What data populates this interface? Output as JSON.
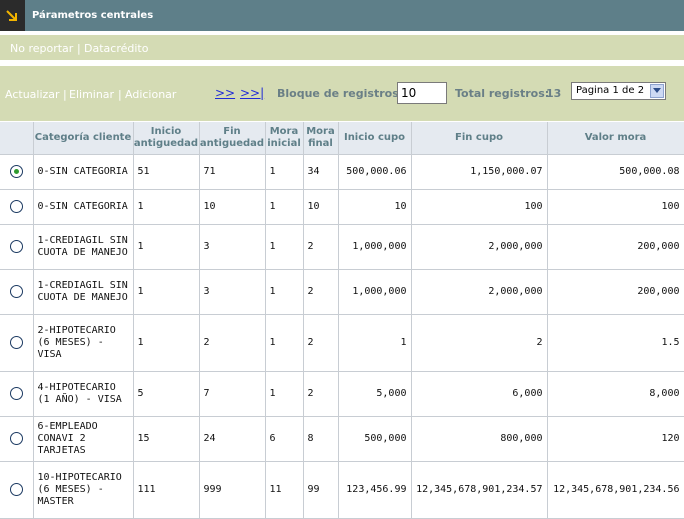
{
  "header": {
    "title": "Párametros centrales"
  },
  "subnav": {
    "no_reportar": "No reportar",
    "separator": "|",
    "datacredito": "Datacrédito"
  },
  "toolbar": {
    "actualizar": "Actualizar",
    "eliminar": "Eliminar",
    "adicionar": "Adicionar",
    "separator": "|",
    "next_link": ">>",
    "last_link": ">>|",
    "bloque_label": "Bloque de registros:",
    "bloque_value": "10",
    "total_label": "Total registros:",
    "total_value": "13",
    "page_select": "Pagina 1 de 2"
  },
  "table": {
    "columns": [
      "",
      "Categoría cliente",
      "Inicio antiguedad",
      "Fin antiguedad",
      "Mora inicial",
      "Mora final",
      "Inicio cupo",
      "Fin cupo",
      "Valor mora"
    ],
    "rows": [
      {
        "selected": true,
        "categoria": "0-SIN CATEGORIA",
        "inicio_ant": "51",
        "fin_ant": "71",
        "mora_ini": "1",
        "mora_fin": "34",
        "inicio_cupo": "500,000.06",
        "fin_cupo": "1,150,000.07",
        "valor_mora": "500,000.08"
      },
      {
        "selected": false,
        "categoria": "0-SIN CATEGORIA",
        "inicio_ant": "1",
        "fin_ant": "10",
        "mora_ini": "1",
        "mora_fin": "10",
        "inicio_cupo": "10",
        "fin_cupo": "100",
        "valor_mora": "100"
      },
      {
        "selected": false,
        "categoria": "1-CREDIAGIL SIN CUOTA DE MANEJO",
        "inicio_ant": "1",
        "fin_ant": "3",
        "mora_ini": "1",
        "mora_fin": "2",
        "inicio_cupo": "1,000,000",
        "fin_cupo": "2,000,000",
        "valor_mora": "200,000"
      },
      {
        "selected": false,
        "categoria": "1-CREDIAGIL SIN CUOTA DE MANEJO",
        "inicio_ant": "1",
        "fin_ant": "3",
        "mora_ini": "1",
        "mora_fin": "2",
        "inicio_cupo": "1,000,000",
        "fin_cupo": "2,000,000",
        "valor_mora": "200,000"
      },
      {
        "selected": false,
        "categoria": "2-HIPOTECARIO (6 MESES) - VISA",
        "inicio_ant": "1",
        "fin_ant": "2",
        "mora_ini": "1",
        "mora_fin": "2",
        "inicio_cupo": "1",
        "fin_cupo": "2",
        "valor_mora": "1.5"
      },
      {
        "selected": false,
        "categoria": "4-HIPOTECARIO (1 AÑO) - VISA",
        "inicio_ant": "5",
        "fin_ant": "7",
        "mora_ini": "1",
        "mora_fin": "2",
        "inicio_cupo": "5,000",
        "fin_cupo": "6,000",
        "valor_mora": "8,000"
      },
      {
        "selected": false,
        "categoria": "6-EMPLEADO CONAVI 2 TARJETAS",
        "inicio_ant": "15",
        "fin_ant": "24",
        "mora_ini": "6",
        "mora_fin": "8",
        "inicio_cupo": "500,000",
        "fin_cupo": "800,000",
        "valor_mora": "120"
      },
      {
        "selected": false,
        "categoria": "10-HIPOTECARIO (6 MESES) - MASTER",
        "inicio_ant": "111",
        "fin_ant": "999",
        "mora_ini": "11",
        "mora_fin": "99",
        "inicio_cupo": "123,456.99",
        "fin_cupo": "12,345,678,901,234.57",
        "valor_mora": "12,345,678,901,234.56"
      }
    ]
  },
  "colors": {
    "title_bar": "#5e7f89",
    "toolbar_bg": "#d4dbb4",
    "header_text": "#5f7f88",
    "link": "#1f2bd6",
    "radio_selected": "#2e9a2e"
  },
  "icons": {
    "logo": "corner-arrow-icon",
    "select_arrow": "chevron-down-icon"
  }
}
